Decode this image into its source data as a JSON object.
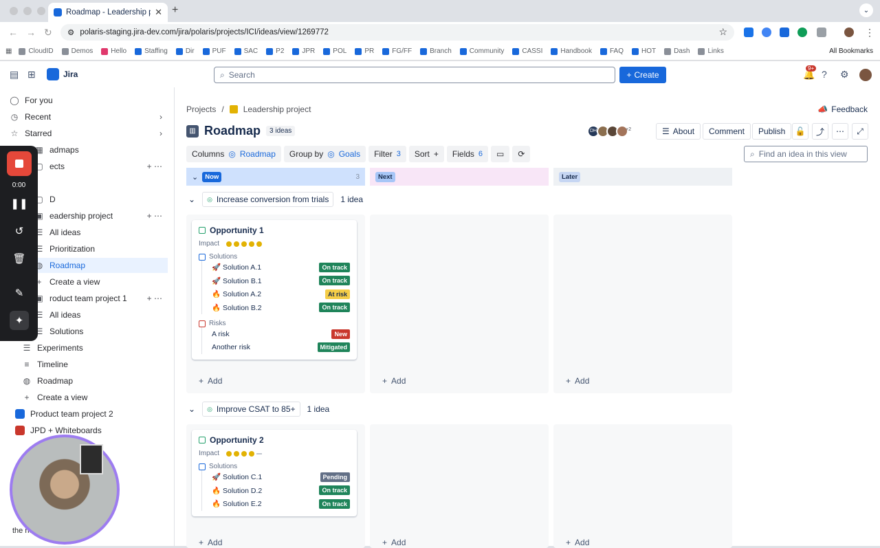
{
  "browser": {
    "tab_title": "Roadmap - Leadership projec",
    "url": "polaris-staging.jira-dev.com/jira/polaris/projects/ICI/ideas/view/1269772",
    "bookmarks": [
      "CloudID",
      "Demos",
      "Hello",
      "Staffing",
      "Dir",
      "PUF",
      "SAC",
      "P2",
      "JPR",
      "POL",
      "PR",
      "FG/FF",
      "Branch",
      "Community",
      "CASSI",
      "Handbook",
      "FAQ",
      "HOT",
      "Dash",
      "Links"
    ],
    "all_bookmarks": "All Bookmarks"
  },
  "topnav": {
    "app_name": "Jira",
    "search_placeholder": "Search",
    "create_label": "Create",
    "notif_badge": "9+"
  },
  "sidebar": {
    "items": [
      {
        "label": "For you",
        "icon": "user-icon"
      },
      {
        "label": "Recent",
        "icon": "clock-icon"
      },
      {
        "label": "Starred",
        "icon": "star-icon"
      },
      {
        "label": "admaps",
        "icon": "map-icon"
      },
      {
        "label": "ects",
        "icon": "folder-icon"
      },
      {
        "label": "D",
        "icon": "folder-icon"
      },
      {
        "label": "eadership project",
        "icon": "project-icon"
      },
      {
        "label": "All ideas",
        "icon": "list-icon"
      },
      {
        "label": "Prioritization",
        "icon": "list-icon"
      },
      {
        "label": "Roadmap",
        "icon": "globe-icon"
      },
      {
        "label": "Create a view",
        "icon": "plus-icon"
      },
      {
        "label": "roduct team project 1",
        "icon": "project-icon"
      },
      {
        "label": "All ideas",
        "icon": "list-icon"
      },
      {
        "label": "Solutions",
        "icon": "list-icon"
      },
      {
        "label": "Experiments",
        "icon": "list-icon"
      },
      {
        "label": "Timeline",
        "icon": "timeline-icon"
      },
      {
        "label": "Roadmap",
        "icon": "globe-icon"
      },
      {
        "label": "Create a view",
        "icon": "plus-icon"
      },
      {
        "label": "Product team project 2",
        "icon": "project-icon"
      },
      {
        "label": "JPD + Whiteboards",
        "icon": "project-icon"
      }
    ],
    "footer": "Give feedback on the new navigation",
    "footer_visible": "the new navigation"
  },
  "recorder": {
    "time": "0:00"
  },
  "main": {
    "breadcrumb_projects": "Projects",
    "breadcrumb_sep": "/",
    "breadcrumb_project": "Leadership project",
    "feedback": "Feedback",
    "title": "Roadmap",
    "idea_count": "3 ideas",
    "avatar_initials": "DH",
    "more_avatars": "+2",
    "about": "About",
    "comment": "Comment",
    "publish": "Publish",
    "toolbar": {
      "columns": "Columns",
      "columns_value": "Roadmap",
      "group_by": "Group by",
      "group_value": "Goals",
      "filter": "Filter",
      "filter_count": "3",
      "sort": "Sort",
      "fields": "Fields",
      "fields_count": "6"
    },
    "find_placeholder": "Find an idea in this view",
    "columns": [
      {
        "label": "Now",
        "count": "3",
        "bg": "#cfe1fd",
        "chip": "#1868db"
      },
      {
        "label": "Next",
        "count": "",
        "bg": "#f8e6f7",
        "chip": "#a7c6f7"
      },
      {
        "label": "Later",
        "count": "",
        "bg": "#eef1f4",
        "chip": "#c6d6f3"
      }
    ],
    "add_label": "Add",
    "groups": [
      {
        "goal": "Increase conversion from trials",
        "count": "1 idea",
        "card": {
          "title": "Opportunity 1",
          "impact_label": "Impact",
          "impact_level": 5,
          "solutions_label": "Solutions",
          "solutions": [
            {
              "icon": "rocket-icon",
              "name": "Solution A.1",
              "status": "On track",
              "tone": "g"
            },
            {
              "icon": "rocket-icon",
              "name": "Solution B.1",
              "status": "On track",
              "tone": "g"
            },
            {
              "icon": "fire-icon",
              "name": "Solution A.2",
              "status": "At risk",
              "tone": "y"
            },
            {
              "icon": "fire-icon",
              "name": "Solution B.2",
              "status": "On track",
              "tone": "g"
            }
          ],
          "risks_label": "Risks",
          "risks": [
            {
              "name": "A risk",
              "status": "New",
              "tone": "r"
            },
            {
              "name": "Another risk",
              "status": "Mitigated",
              "tone": "g"
            }
          ]
        }
      },
      {
        "goal": "Improve CSAT to 85+",
        "count": "1 idea",
        "card": {
          "title": "Opportunity 2",
          "impact_label": "Impact",
          "impact_level": 4,
          "solutions_label": "Solutions",
          "solutions": [
            {
              "icon": "rocket-icon",
              "name": "Solution C.1",
              "status": "Pending",
              "tone": "p"
            },
            {
              "icon": "fire-icon",
              "name": "Solution D.2",
              "status": "On track",
              "tone": "g"
            },
            {
              "icon": "fire-icon",
              "name": "Solution E.2",
              "status": "On track",
              "tone": "g"
            }
          ]
        }
      }
    ]
  }
}
